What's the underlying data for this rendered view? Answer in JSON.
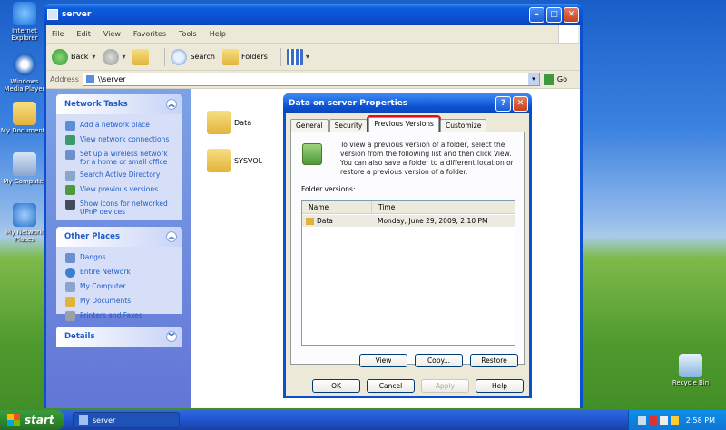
{
  "desktop": {
    "icons": [
      {
        "label": "Internet Explorer",
        "icon": "internet-explorer-icon"
      },
      {
        "label": "Windows Media Player",
        "icon": "media-player-icon"
      },
      {
        "label": "My Documents",
        "icon": "my-documents-icon"
      },
      {
        "label": "My Computer",
        "icon": "my-computer-icon"
      },
      {
        "label": "My Network Places",
        "icon": "network-places-icon"
      },
      {
        "label": "Recycle Bin",
        "icon": "recycle-bin-icon"
      }
    ]
  },
  "window": {
    "title": "server",
    "menu": [
      "File",
      "Edit",
      "View",
      "Favorites",
      "Tools",
      "Help"
    ],
    "toolbar": {
      "back": "Back",
      "search": "Search",
      "folders": "Folders"
    },
    "address": {
      "label": "Address",
      "value": "\\\\server",
      "go": "Go"
    },
    "network_tasks": {
      "title": "Network Tasks",
      "items": [
        "Add a network place",
        "View network connections",
        "Set up a wireless network for a home or small office",
        "Search Active Directory",
        "View previous versions",
        "Show icons for networked UPnP devices"
      ]
    },
    "other_places": {
      "title": "Other Places",
      "items": [
        "Dangns",
        "Entire Network",
        "My Computer",
        "My Documents",
        "Printers and Faxes"
      ]
    },
    "details": {
      "title": "Details"
    },
    "files": [
      "Data",
      "SYSVOL"
    ]
  },
  "dialog": {
    "title": "Data on server Properties",
    "tabs": [
      "General",
      "Security",
      "Previous Versions",
      "Customize"
    ],
    "active_tab": "Previous Versions",
    "intro": "To view a previous version of a folder, select the version from the following list and then click View.  You can also save a folder to a different location or restore a previous version of a folder.",
    "folder_versions_label": "Folder versions:",
    "columns": [
      "Name",
      "Time"
    ],
    "rows": [
      {
        "name": "Data",
        "time": "Monday, June 29, 2009, 2:10 PM"
      }
    ],
    "list_buttons": {
      "view": "View",
      "copy": "Copy...",
      "restore": "Restore"
    },
    "footer_buttons": {
      "ok": "OK",
      "cancel": "Cancel",
      "apply": "Apply",
      "help": "Help"
    }
  },
  "taskbar": {
    "start": "start",
    "task": "server",
    "clock": "2:58 PM"
  }
}
